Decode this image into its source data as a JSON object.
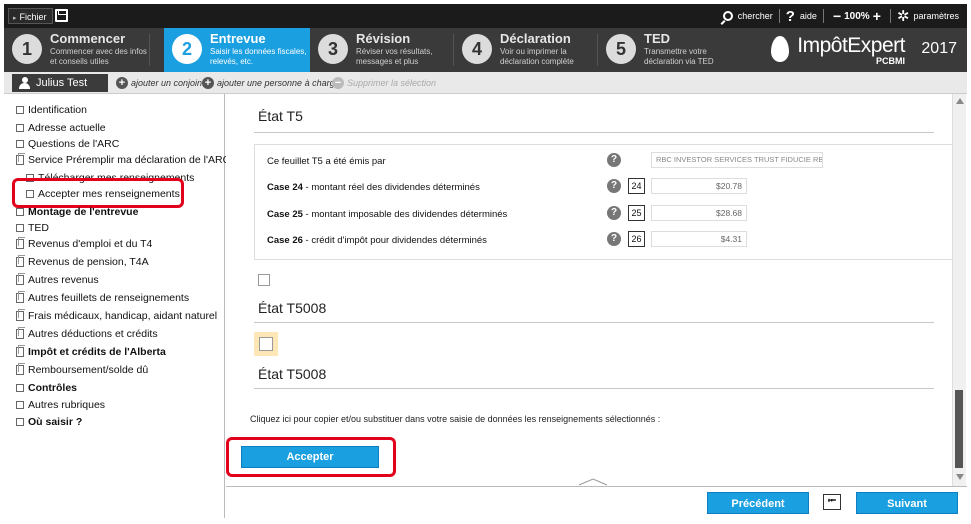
{
  "topbar": {
    "fichier_label": "Fichier",
    "search_label": "chercher",
    "help_label": "aide",
    "zoom_level": "100%",
    "settings_label": "paramètres"
  },
  "steps": [
    {
      "number": "1",
      "title": "Commencer",
      "desc1": "Commencer avec des infos",
      "desc2": "et conseils utiles"
    },
    {
      "number": "2",
      "title": "Entrevue",
      "desc1": "Saisir les données fiscales,",
      "desc2": "relevés, etc."
    },
    {
      "number": "3",
      "title": "Révision",
      "desc1": "Réviser vos résultats,",
      "desc2": "messages et plus"
    },
    {
      "number": "4",
      "title": "Déclaration",
      "desc1": "Voir ou imprimer la",
      "desc2": "déclaration complète"
    },
    {
      "number": "5",
      "title": "TED",
      "desc1": "Transmettre votre",
      "desc2": "déclaration via TED"
    }
  ],
  "logo": {
    "name": "ImpôtExpert",
    "year": "2017",
    "sub": "PCBMI"
  },
  "personbar": {
    "person_name": "Julius Test",
    "add_spouse": "ajouter un conjoint",
    "add_dependant": "ajouter une personne à charge",
    "delete_selection": "Supprimer la sélection"
  },
  "sidebar": {
    "items": [
      {
        "label": "Identification"
      },
      {
        "label": "Adresse actuelle"
      },
      {
        "label": "Questions de l'ARC"
      },
      {
        "label": "Service Préremplir ma déclaration de l'ARC"
      },
      {
        "label": "Télécharger mes renseignements"
      },
      {
        "label": "Accepter mes renseignements"
      },
      {
        "label": "Montage de l'entrevue"
      },
      {
        "label": "TED"
      },
      {
        "label": "Revenus d'emploi et du T4"
      },
      {
        "label": "Revenus de pension, T4A"
      },
      {
        "label": "Autres revenus"
      },
      {
        "label": "Autres feuillets de renseignements"
      },
      {
        "label": "Frais médicaux, handicap, aidant naturel"
      },
      {
        "label": "Autres déductions et crédits"
      },
      {
        "label": "Impôt et crédits de l'Alberta"
      },
      {
        "label": "Remboursement/solde dû"
      },
      {
        "label": "Contrôles"
      },
      {
        "label": "Autres rubriques"
      },
      {
        "label": "Où saisir ?"
      }
    ]
  },
  "main": {
    "t5_title": "État T5",
    "issuer_label": "Ce feuillet T5 a été émis par",
    "issuer_value": "RBC INVESTOR SERVICES TRUST FIDUCIE RBI",
    "rows": [
      {
        "case": "Case 24",
        "desc": " - montant réel des dividendes déterminés",
        "box": "24",
        "value": "$20.78"
      },
      {
        "case": "Case 25",
        "desc": " - montant imposable des dividendes déterminés",
        "box": "25",
        "value": "$28.68"
      },
      {
        "case": "Case 26",
        "desc": " - crédit d'impôt pour dividendes déterminés",
        "box": "26",
        "value": "$4.31"
      }
    ],
    "t5008_title_1": "État T5008",
    "t5008_title_2": "État T5008",
    "instruction": "Cliquez ici pour copier et/ou substituer dans votre saisie de données les renseignements sélectionnés :",
    "accept_label": "Accepter"
  },
  "footer": {
    "prev_label": "Précédent",
    "back_symbol": "⭰",
    "next_label": "Suivant"
  },
  "colors": {
    "accent": "#1a9fe0",
    "highlight_outline": "#e2001a",
    "dark_bar": "#1b1b1b"
  }
}
